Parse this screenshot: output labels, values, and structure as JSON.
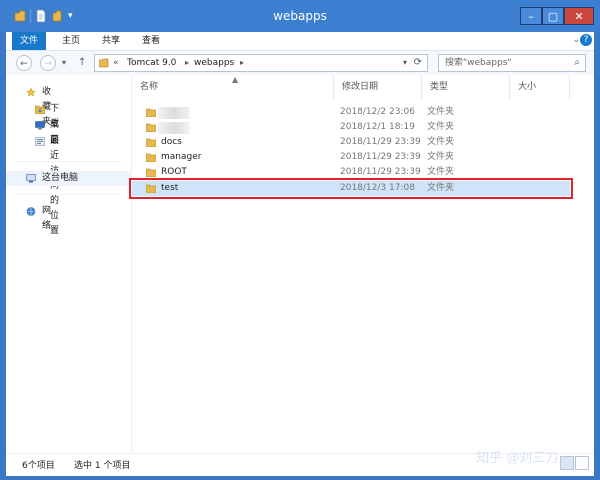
{
  "window": {
    "title": "webapps"
  },
  "ribbon": {
    "tabs": [
      "文件",
      "主页",
      "共享",
      "查看"
    ]
  },
  "address": {
    "prefix": "«",
    "crumbs": [
      "Tomcat 9.0",
      "webapps"
    ]
  },
  "search": {
    "placeholder": "搜索\"webapps\""
  },
  "navigation": {
    "favorites": "收藏夹",
    "downloads": "下载",
    "desktop": "桌面",
    "recent": "最近访问的位置",
    "this_pc": "这台电脑",
    "network": "网络"
  },
  "columns": {
    "name": "名称",
    "date": "修改日期",
    "type": "类型",
    "size": "大小"
  },
  "files": [
    {
      "name": "",
      "date": "2018/12/2 23:06",
      "type": "文件夹"
    },
    {
      "name": "",
      "date": "2018/12/1 18:19",
      "type": "文件夹"
    },
    {
      "name": "docs",
      "date": "2018/11/29 23:39",
      "type": "文件夹"
    },
    {
      "name": "manager",
      "date": "2018/11/29 23:39",
      "type": "文件夹"
    },
    {
      "name": "ROOT",
      "date": "2018/11/29 23:39",
      "type": "文件夹"
    },
    {
      "name": "test",
      "date": "2018/12/3 17:08",
      "type": "文件夹"
    }
  ],
  "status": {
    "count": "6个项目",
    "selected": "选中 1 个项目"
  },
  "watermark": "知乎 @刘三刀",
  "colors": {
    "title_bar": "#3c7fd0",
    "selection": "#cfe3f9",
    "highlight_box": "#e0232b",
    "folder": "#e6b84f"
  },
  "icons": [
    "folder-icon",
    "document-icon",
    "star-icon",
    "download-icon",
    "desktop-icon",
    "recent-places-icon",
    "computer-icon",
    "network-icon",
    "back-arrow-icon",
    "forward-arrow-icon",
    "up-arrow-icon",
    "refresh-icon",
    "search-icon",
    "minimize-icon",
    "maximize-icon",
    "close-icon",
    "help-icon"
  ]
}
